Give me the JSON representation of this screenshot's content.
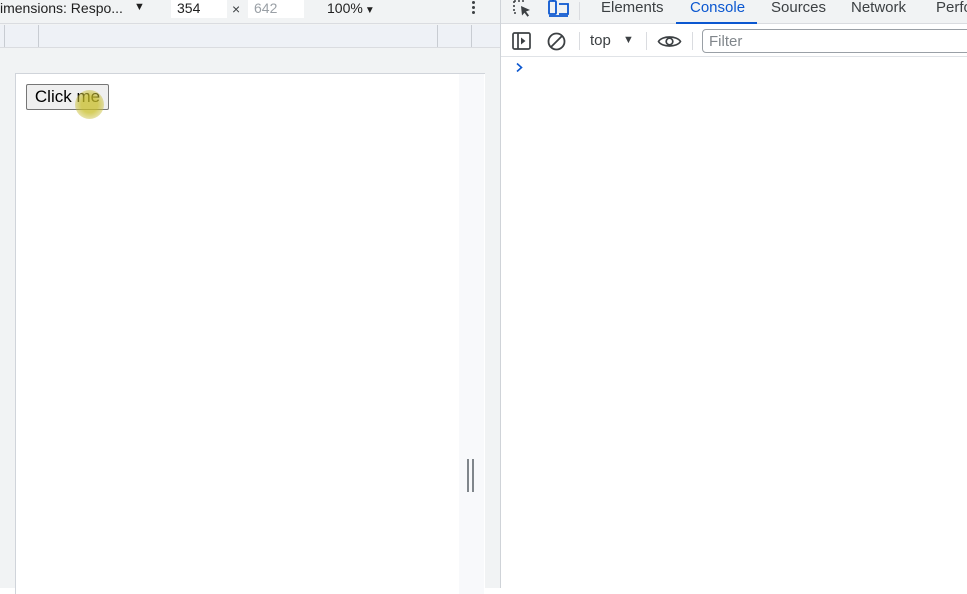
{
  "device_toolbar": {
    "dimensions_label": "imensions: Respo...",
    "width_value": "354",
    "height_value": "642",
    "times_sign": "×",
    "zoom_value": "100%"
  },
  "page": {
    "button_label": "Click me"
  },
  "devtools": {
    "tabs": [
      {
        "label": "Elements"
      },
      {
        "label": "Console"
      },
      {
        "label": "Sources"
      },
      {
        "label": "Network"
      },
      {
        "label": "Perfo"
      }
    ],
    "active_tab": "Console",
    "accent_color": "#0b57d0",
    "console_toolbar": {
      "context_value": "top",
      "filter_placeholder": "Filter"
    },
    "icons": [
      "inspect-element-icon",
      "device-toggle-icon",
      "sidebar-toggle-icon",
      "clear-console-icon",
      "eye-icon",
      "prompt-chevron-icon",
      "kebab-menu-icon"
    ]
  }
}
